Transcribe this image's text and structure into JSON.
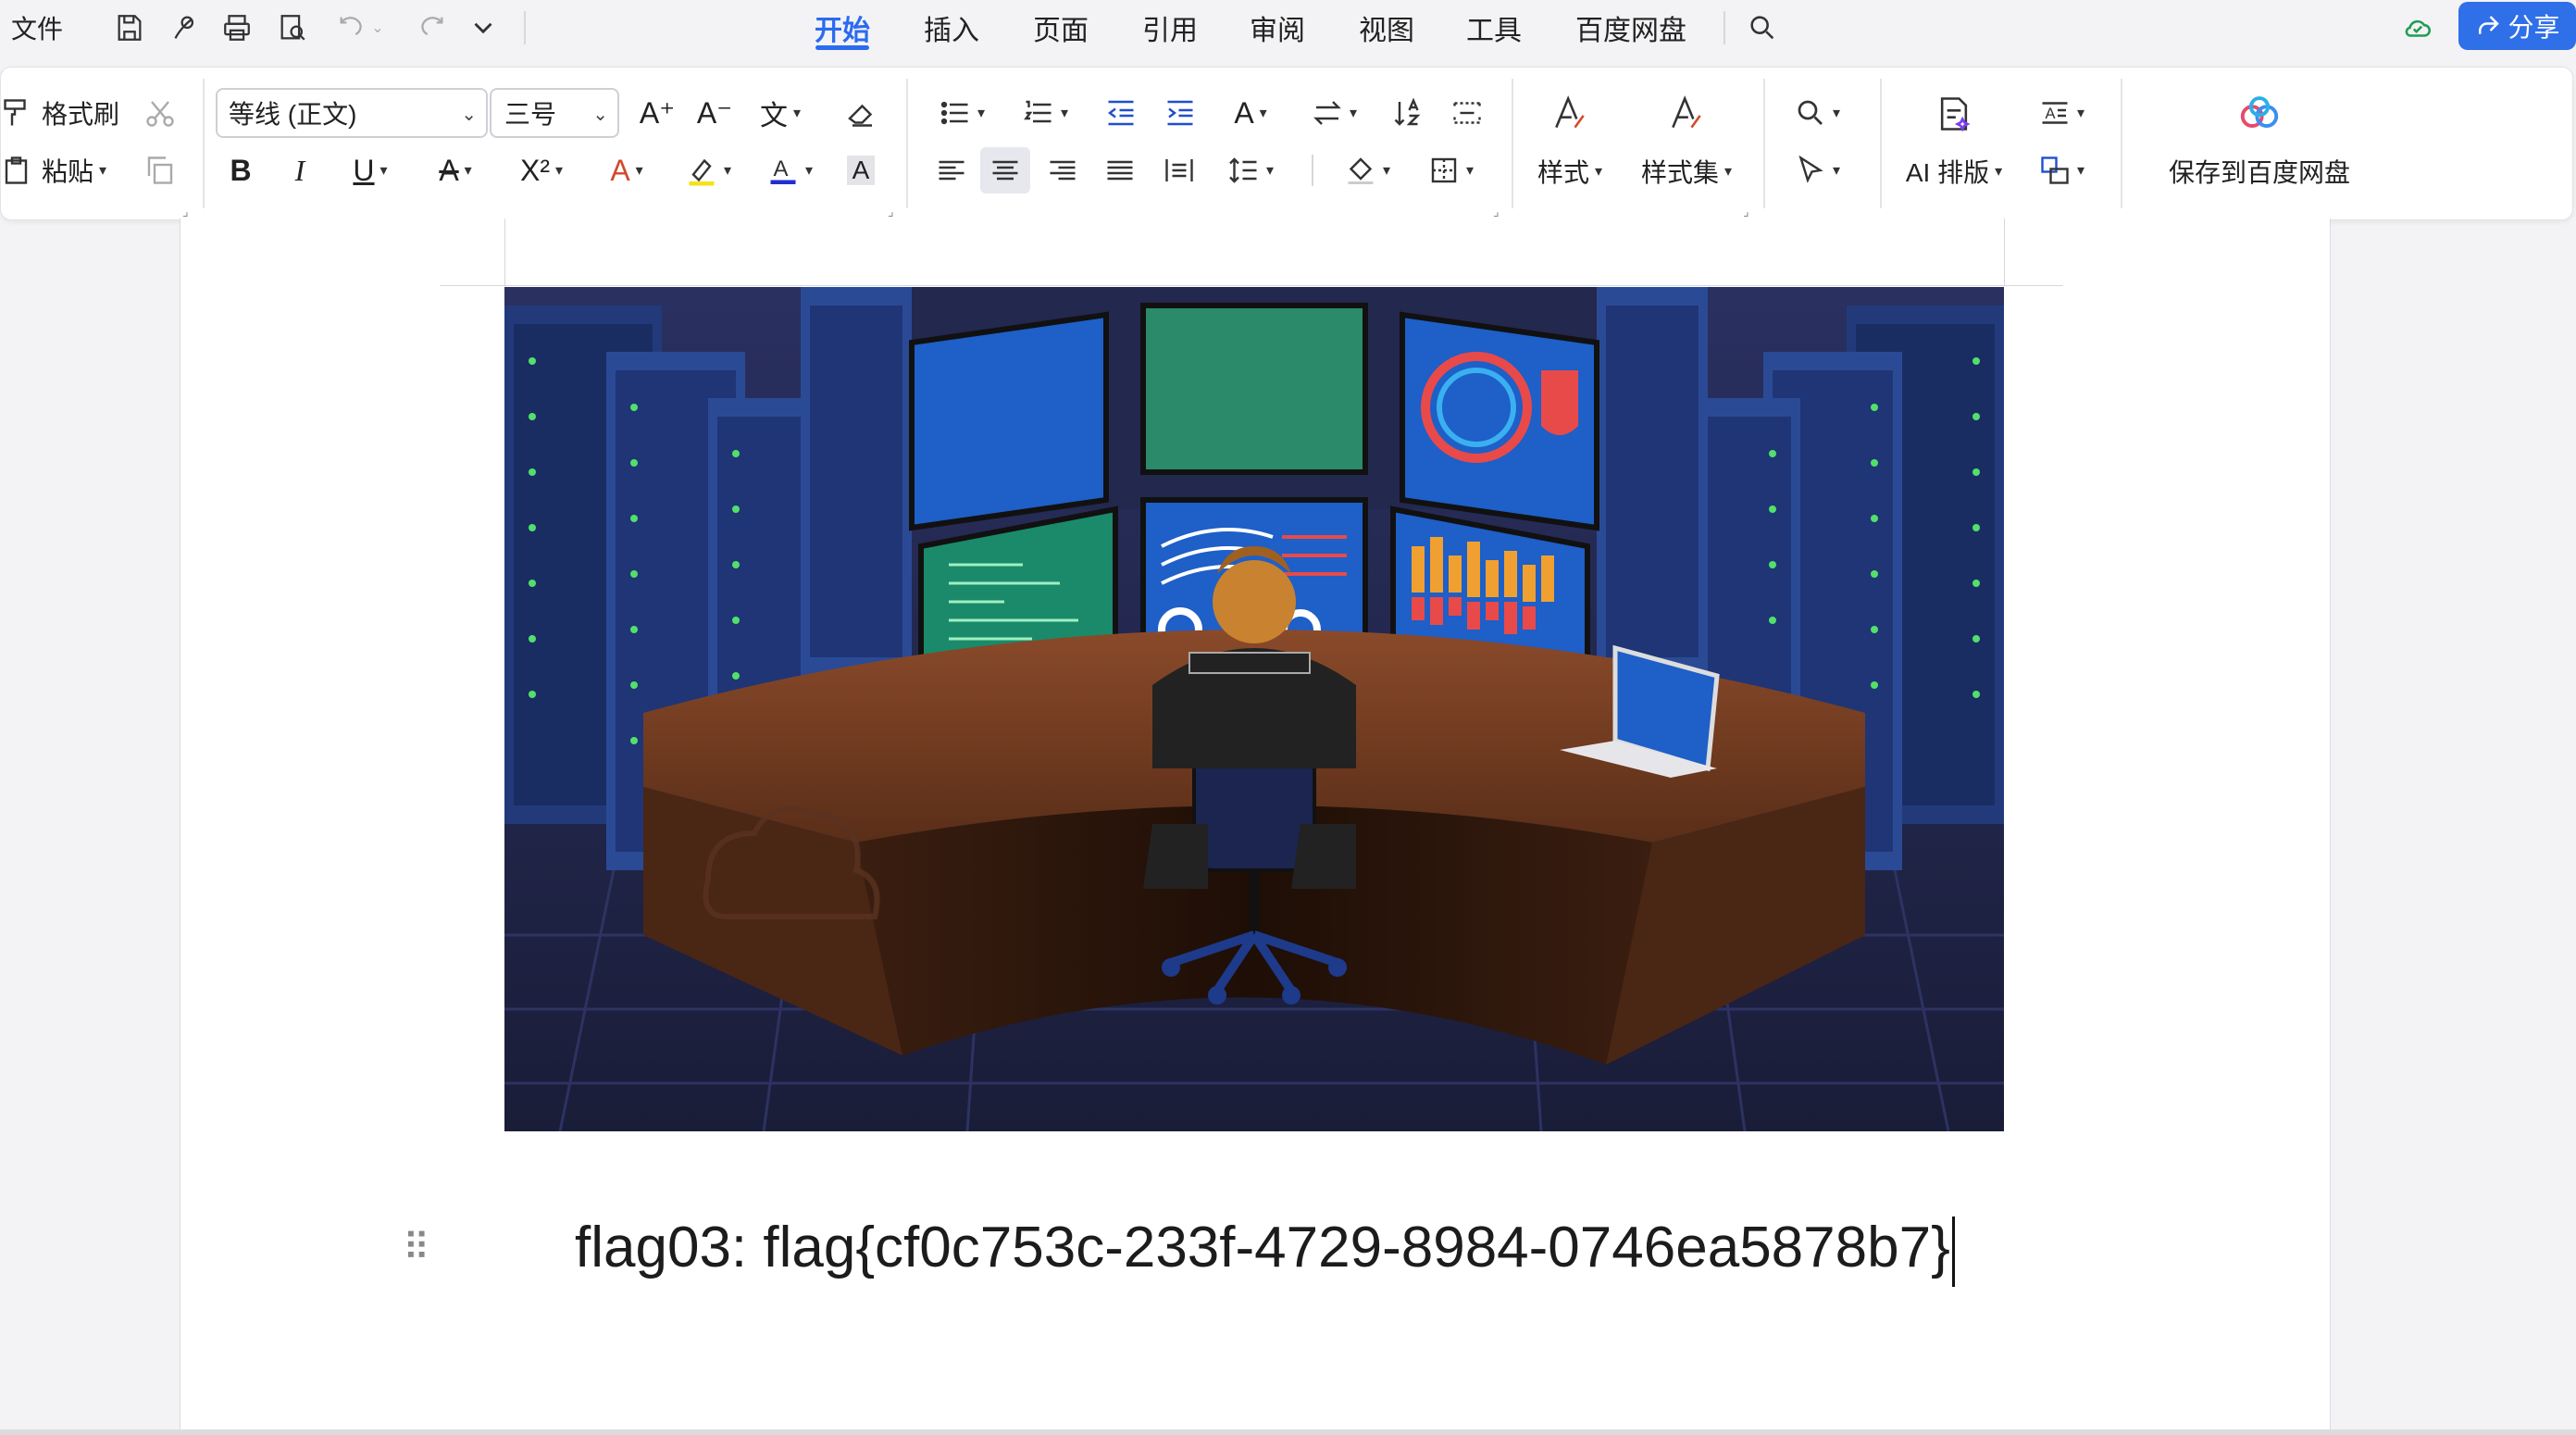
{
  "titlebar": {
    "file_menu": "文件",
    "tabs": [
      {
        "label": "开始",
        "active": true
      },
      {
        "label": "插入",
        "active": false
      },
      {
        "label": "页面",
        "active": false
      },
      {
        "label": "引用",
        "active": false
      },
      {
        "label": "审阅",
        "active": false
      },
      {
        "label": "视图",
        "active": false
      },
      {
        "label": "工具",
        "active": false
      },
      {
        "label": "百度网盘",
        "active": false
      }
    ],
    "share_label": "分享",
    "accent_color": "#2a6bf0",
    "share_color": "#2f6fe8"
  },
  "ribbon": {
    "format_painter": "格式刷",
    "paste": "粘贴",
    "font_name": "等线 (正文)",
    "font_size": "三号",
    "bold": "B",
    "italic": "I",
    "underline": "U",
    "superscript": "X²",
    "font_color_letter": "A",
    "char_shading_letter": "A",
    "style_label": "样式",
    "style_set_label": "样式集",
    "ai_layout_label": "AI 排版",
    "save_baidu_label": "保存到百度网盘",
    "font_color": "#1f2fd0",
    "highlight_color": "#f6e21a"
  },
  "document": {
    "paragraph_text": "flag03: flag{cf0c753c-233f-4729-8984-0746ea5878b7}",
    "image_description": "cartoon-operator-at-curved-desk-with-monitors-and-server-racks"
  }
}
